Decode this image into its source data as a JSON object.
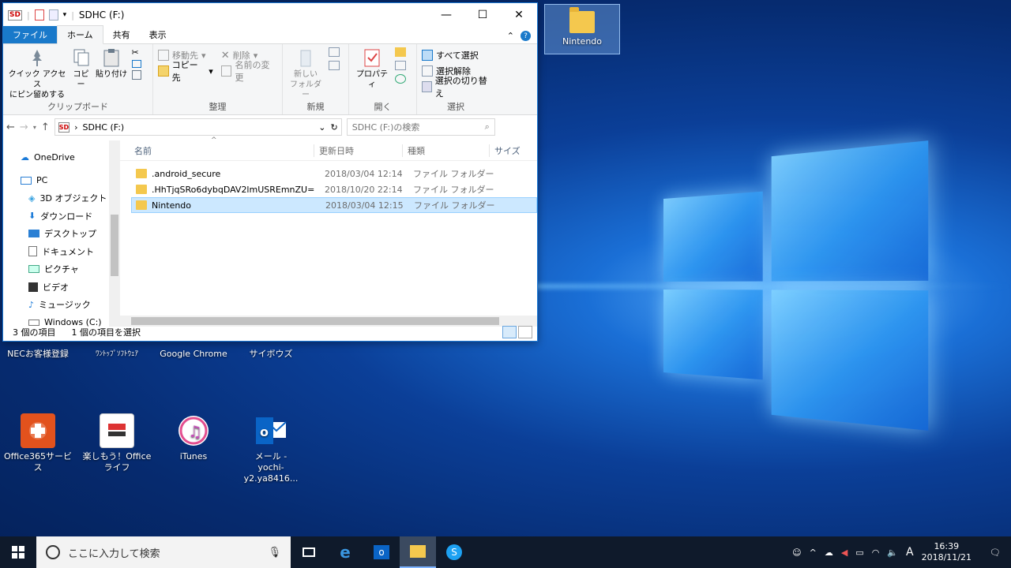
{
  "explorer": {
    "title": "SDHC (F:)",
    "tabs": {
      "file": "ファイル",
      "home": "ホーム",
      "share": "共有",
      "view": "表示"
    },
    "ribbon": {
      "clipboard": {
        "name": "クリップボード",
        "pin": "クイック アクセス\nにピン留めする",
        "copy": "コピー",
        "paste": "貼り付け"
      },
      "organize": {
        "name": "整理",
        "move_to": "移動先",
        "copy_to": "コピー先",
        "delete": "削除",
        "rename": "名前の変更"
      },
      "new": {
        "name": "新規",
        "new_folder": "新しい\nフォルダー"
      },
      "open": {
        "name": "開く",
        "properties": "プロパティ"
      },
      "select": {
        "name": "選択",
        "select_all": "すべて選択",
        "select_none": "選択解除",
        "invert": "選択の切り替え"
      }
    },
    "address": "SDHC (F:)",
    "search_placeholder": "SDHC (F:)の検索",
    "columns": {
      "name": "名前",
      "date": "更新日時",
      "type": "種類",
      "size": "サイズ"
    },
    "files": [
      {
        "name": ".android_secure",
        "date": "2018/03/04 12:14",
        "type": "ファイル フォルダー"
      },
      {
        "name": ".HhTjqSRo6dybqDAV2lmUSREmnZU=",
        "date": "2018/10/20 22:14",
        "type": "ファイル フォルダー"
      },
      {
        "name": "Nintendo",
        "date": "2018/03/04 12:15",
        "type": "ファイル フォルダー"
      }
    ],
    "nav": [
      {
        "label": "OneDrive",
        "icon": "cloud-icon"
      },
      {
        "label": "PC",
        "icon": "pc-icon"
      },
      {
        "label": "3D オブジェクト",
        "icon": "cube-icon"
      },
      {
        "label": "ダウンロード",
        "icon": "download-icon"
      },
      {
        "label": "デスクトップ",
        "icon": "desktop-icon"
      },
      {
        "label": "ドキュメント",
        "icon": "document-icon"
      },
      {
        "label": "ピクチャ",
        "icon": "picture-icon"
      },
      {
        "label": "ビデオ",
        "icon": "video-icon"
      },
      {
        "label": "ミュージック",
        "icon": "music-icon"
      },
      {
        "label": "Windows (C:)",
        "icon": "drive-icon"
      }
    ],
    "status": {
      "count": "3 個の項目",
      "selected": "1 個の項目を選択"
    }
  },
  "desktop": {
    "icons": [
      {
        "label": "Nintendo"
      },
      {
        "label": "NECお客様登録"
      },
      {
        "label": "ﾜﾝﾄｯﾌﾟｿﾌﾄｳｪｱ"
      },
      {
        "label": "Google Chrome"
      },
      {
        "label": "サイボウズ"
      },
      {
        "label": "Office365サービス"
      },
      {
        "label": "楽しもう！Office ライフ"
      },
      {
        "label": "iTunes"
      },
      {
        "label": "メール -\nyochi-y2.ya8416..."
      }
    ]
  },
  "taskbar": {
    "search_placeholder": "ここに入力して検索",
    "time": "16:39",
    "date": "2018/11/21",
    "ime": "A"
  },
  "colors": {
    "accent": "#1979ca",
    "selection": "#cce8ff",
    "taskbar": "#0f1a2b"
  }
}
